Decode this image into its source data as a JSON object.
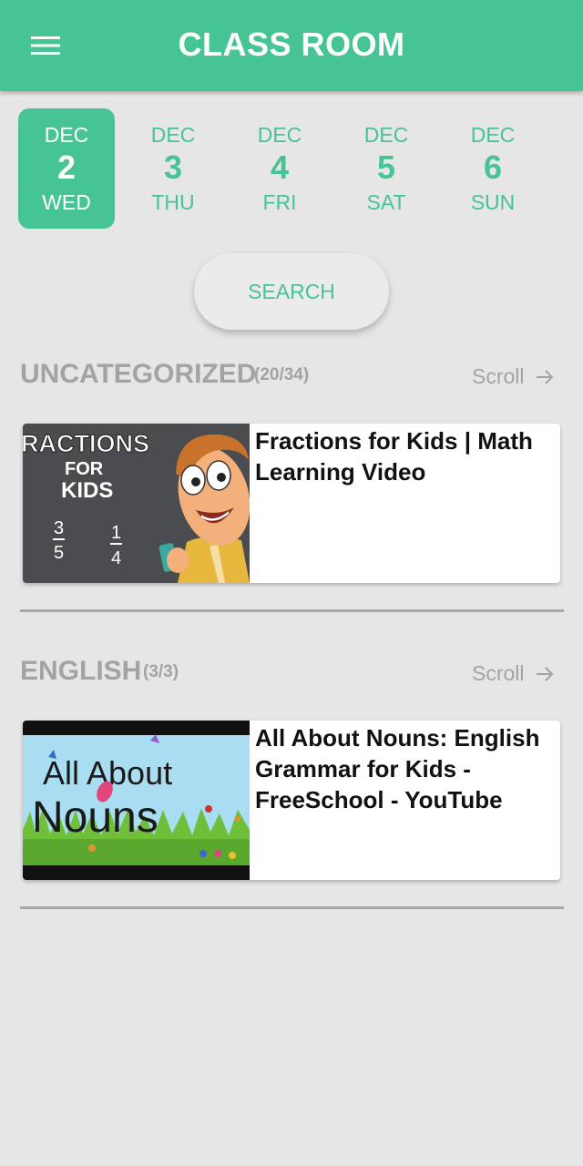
{
  "header": {
    "title": "CLASS ROOM",
    "menu_icon": "hamburger-menu-icon"
  },
  "colors": {
    "accent": "#47c493",
    "background": "#e6e6e6",
    "muted_text": "#a3a3a3"
  },
  "dates": [
    {
      "month": "DEC",
      "day": "2",
      "weekday": "WED",
      "selected": true
    },
    {
      "month": "DEC",
      "day": "3",
      "weekday": "THU",
      "selected": false
    },
    {
      "month": "DEC",
      "day": "4",
      "weekday": "FRI",
      "selected": false
    },
    {
      "month": "DEC",
      "day": "5",
      "weekday": "SAT",
      "selected": false
    },
    {
      "month": "DEC",
      "day": "6",
      "weekday": "SUN",
      "selected": false
    }
  ],
  "search": {
    "label": "SEARCH"
  },
  "sections": [
    {
      "title": "UNCATEGORIZED",
      "count": "(20/34)",
      "scroll_label": "Scroll",
      "scroll_icon": "arrow-right-icon",
      "videos": [
        {
          "title": "Fractions for Kids | Math Learning Video",
          "thumb": {
            "heading": "RACTIONS",
            "for": "FOR",
            "kids": "KIDS",
            "frac1_num": "3",
            "frac1_den": "5",
            "frac2_num": "1",
            "frac2_den": "4"
          }
        }
      ]
    },
    {
      "title": "ENGLISH",
      "count": "(3/3)",
      "scroll_label": "Scroll",
      "scroll_icon": "arrow-right-icon",
      "videos": [
        {
          "title": "All About Nouns: English Grammar for Kids - FreeSchool - YouTube",
          "thumb": {
            "line1": "All About",
            "line2": "Nouns"
          }
        }
      ]
    }
  ]
}
